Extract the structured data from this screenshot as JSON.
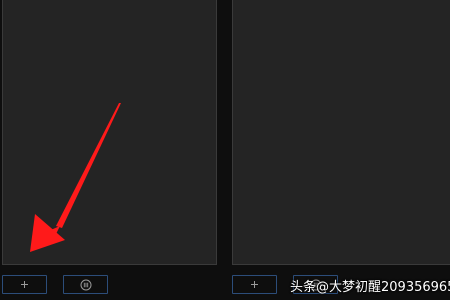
{
  "colors": {
    "background": "#0e0e0e",
    "panel": "#242424",
    "panel_border": "#3a3a3a",
    "button_border": "#2c4d7a",
    "icon": "#9a9a9a",
    "arrow": "#ff1a1a"
  },
  "panels": [
    {
      "add_button": {
        "icon": "plus-icon"
      },
      "delete_button": {
        "icon": "trash-icon"
      }
    },
    {
      "add_button": {
        "icon": "plus-icon"
      },
      "delete_button": {
        "icon": "trash-icon"
      }
    }
  ],
  "annotation": {
    "type": "arrow",
    "color": "#ff1a1a",
    "points_to": "panels.0.add_button"
  },
  "watermark": {
    "text": "头条@大梦初醒209356965"
  }
}
